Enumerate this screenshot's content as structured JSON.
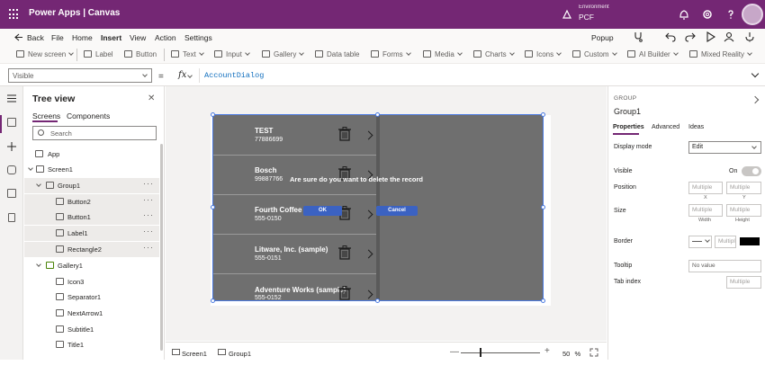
{
  "app": {
    "brand": "Power Apps  |  Canvas",
    "environment_label": "Environment",
    "environment_value": "PCF"
  },
  "menu": {
    "back": "Back",
    "items": [
      "File",
      "Home",
      "Insert",
      "View",
      "Action",
      "Settings"
    ],
    "active": "Insert",
    "popup": "Popup"
  },
  "toolbar": {
    "items": [
      "New screen",
      "Label",
      "Button",
      "Text",
      "Input",
      "Gallery",
      "Data table",
      "Forms",
      "Media",
      "Charts",
      "Icons",
      "Custom",
      "AI Builder",
      "Mixed Reality"
    ]
  },
  "formula": {
    "property": "Visible",
    "equals": "=",
    "fx": "fx",
    "expression": "AccountDialog"
  },
  "tree": {
    "title": "Tree view",
    "tabs": [
      "Screens",
      "Components"
    ],
    "search_placeholder": "Search",
    "nodes": [
      {
        "label": "App"
      },
      {
        "label": "Screen1"
      },
      {
        "label": "Group1"
      },
      {
        "label": "Button2"
      },
      {
        "label": "Button1"
      },
      {
        "label": "Label1"
      },
      {
        "label": "Rectangle2"
      },
      {
        "label": "Gallery1"
      },
      {
        "label": "Icon3"
      },
      {
        "label": "Separator1"
      },
      {
        "label": "NextArrow1"
      },
      {
        "label": "Subtitle1"
      },
      {
        "label": "Title1"
      }
    ]
  },
  "canvas": {
    "gallery_rows": [
      {
        "title": "TEST",
        "subtitle": "77886699"
      },
      {
        "title": "Bosch",
        "subtitle": "99887766"
      },
      {
        "title": "Fourth Coffee (",
        "subtitle": "555-0150"
      },
      {
        "title": "Litware, Inc. (sample)",
        "subtitle": "555-0151"
      },
      {
        "title": "Adventure Works (sample)",
        "subtitle": "555-0152"
      }
    ],
    "dialog_text": "Are sure do you want to delete the record",
    "ok_label": "OK",
    "cancel_label": "Cancel"
  },
  "status": {
    "screen": "Screen1",
    "group": "Group1",
    "zoom": "50",
    "zoom_unit": "%",
    "minus": "—",
    "plus": "+"
  },
  "props": {
    "kind": "GROUP",
    "name": "Group1",
    "tabs": [
      "Properties",
      "Advanced",
      "Ideas"
    ],
    "display_mode_label": "Display mode",
    "display_mode_value": "Edit",
    "visible_label": "Visible",
    "visible_value": "On",
    "position_label": "Position",
    "size_label": "Size",
    "multiple": "Multiple",
    "x_label": "X",
    "y_label": "Y",
    "width_label": "Width",
    "height_label": "Height",
    "border_label": "Border",
    "border_multiple": "Multipl",
    "tooltip_label": "Tooltip",
    "tooltip_value": "No value",
    "tab_index_label": "Tab index",
    "tab_index_value": "Multiple"
  }
}
